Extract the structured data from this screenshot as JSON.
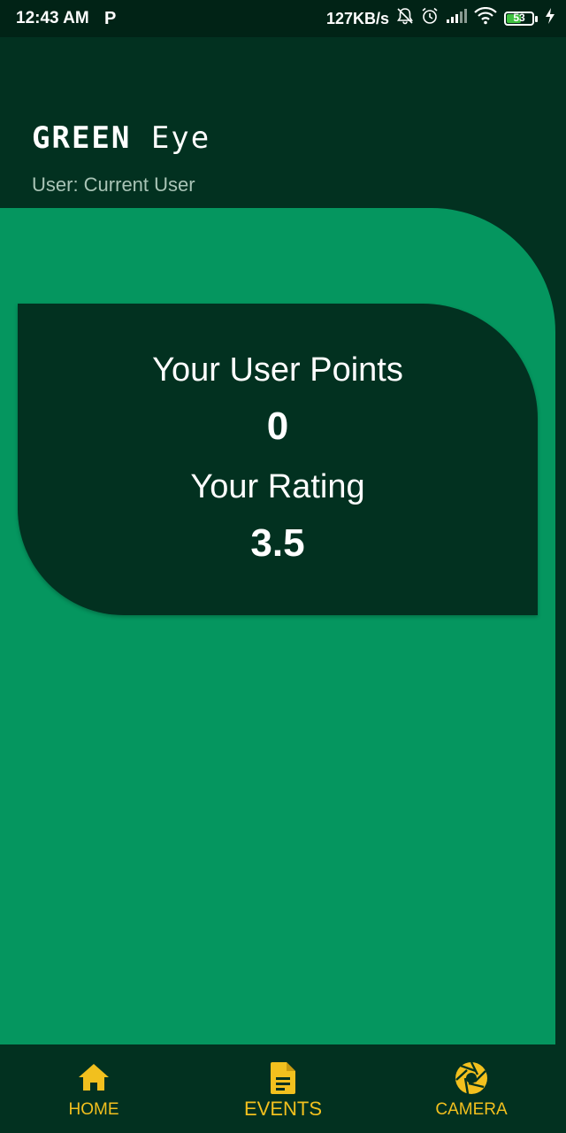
{
  "status_bar": {
    "time": "12:43 AM",
    "notification_letter": "P",
    "network_speed": "127KB/s",
    "battery_level": "53",
    "icons": [
      "notifications-off-icon",
      "alarm-icon",
      "signal-icon",
      "wifi-icon",
      "battery-icon",
      "charging-icon"
    ]
  },
  "header": {
    "title_part1": "GREEN",
    "title_part2": " Eye",
    "user_label": "User: Current User"
  },
  "stats": {
    "points_label": "Your User Points",
    "points_value": "0",
    "rating_label": "Your Rating",
    "rating_value": "3.5"
  },
  "bottom_nav": {
    "items": [
      {
        "label": "HOME",
        "icon": "home-icon"
      },
      {
        "label": "EVENTS",
        "icon": "document-icon"
      },
      {
        "label": "CAMERA",
        "icon": "camera-shutter-icon"
      }
    ]
  },
  "colors": {
    "background_dark": "#023120",
    "status_bar": "#012316",
    "panel_green": "#05965f",
    "accent_yellow": "#f2c01e",
    "subtitle_gray": "#a9c4b6"
  }
}
